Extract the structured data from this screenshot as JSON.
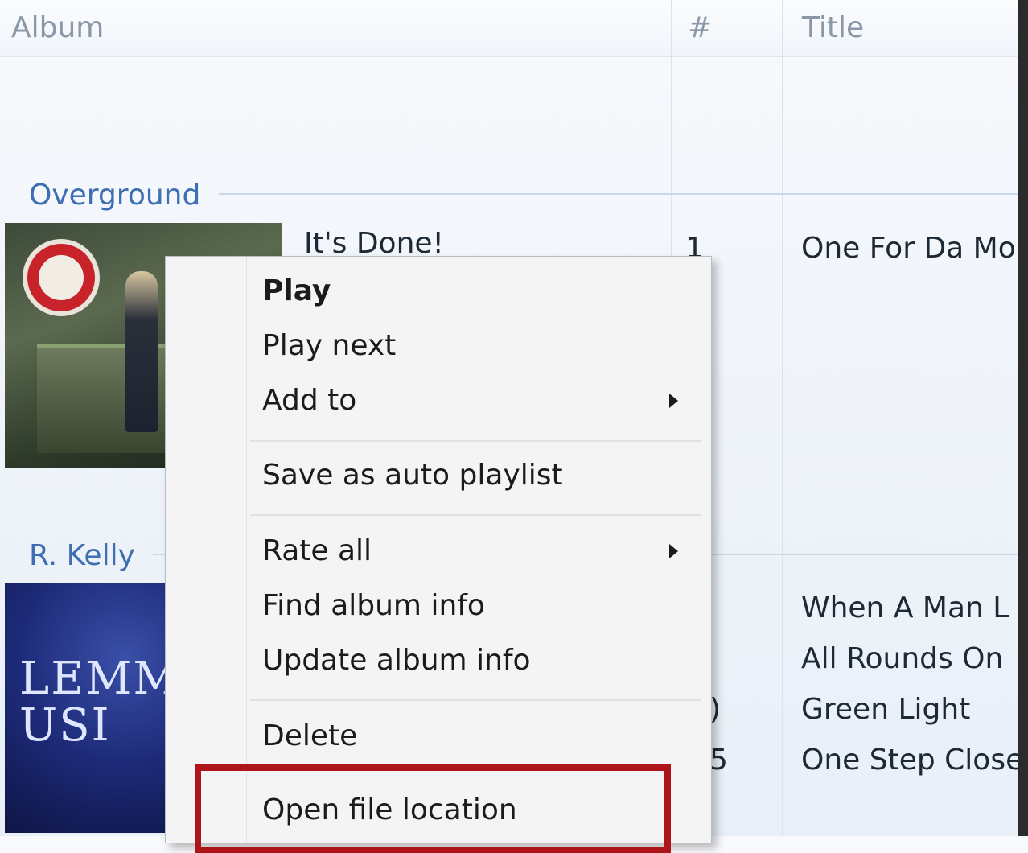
{
  "header": {
    "album_label": "Album",
    "num_label": "#",
    "title_label": "Title"
  },
  "groups": [
    {
      "artist": "Overground",
      "album": "It's Done!",
      "tracks": [
        {
          "num": "1",
          "title": "One For Da Mo"
        }
      ]
    },
    {
      "artist": "R. Kelly",
      "album_art_text": "LEMMI USI",
      "tracks": [
        {
          "num": "",
          "title": "When A Man L"
        },
        {
          "num": "",
          "title": "All Rounds On"
        },
        {
          "num": ")",
          "title": "Green Light"
        },
        {
          "num": "5",
          "title": "One Step Close"
        }
      ]
    }
  ],
  "context_menu": {
    "play": "Play",
    "play_next": "Play next",
    "add_to": "Add to",
    "save_auto_playlist": "Save as auto playlist",
    "rate_all": "Rate all",
    "find_album_info": "Find album info",
    "update_album_info": "Update album info",
    "delete": "Delete",
    "open_file_location": "Open file location"
  },
  "highlight_color": "#b0141b",
  "accent_color": "#3f6fb3"
}
